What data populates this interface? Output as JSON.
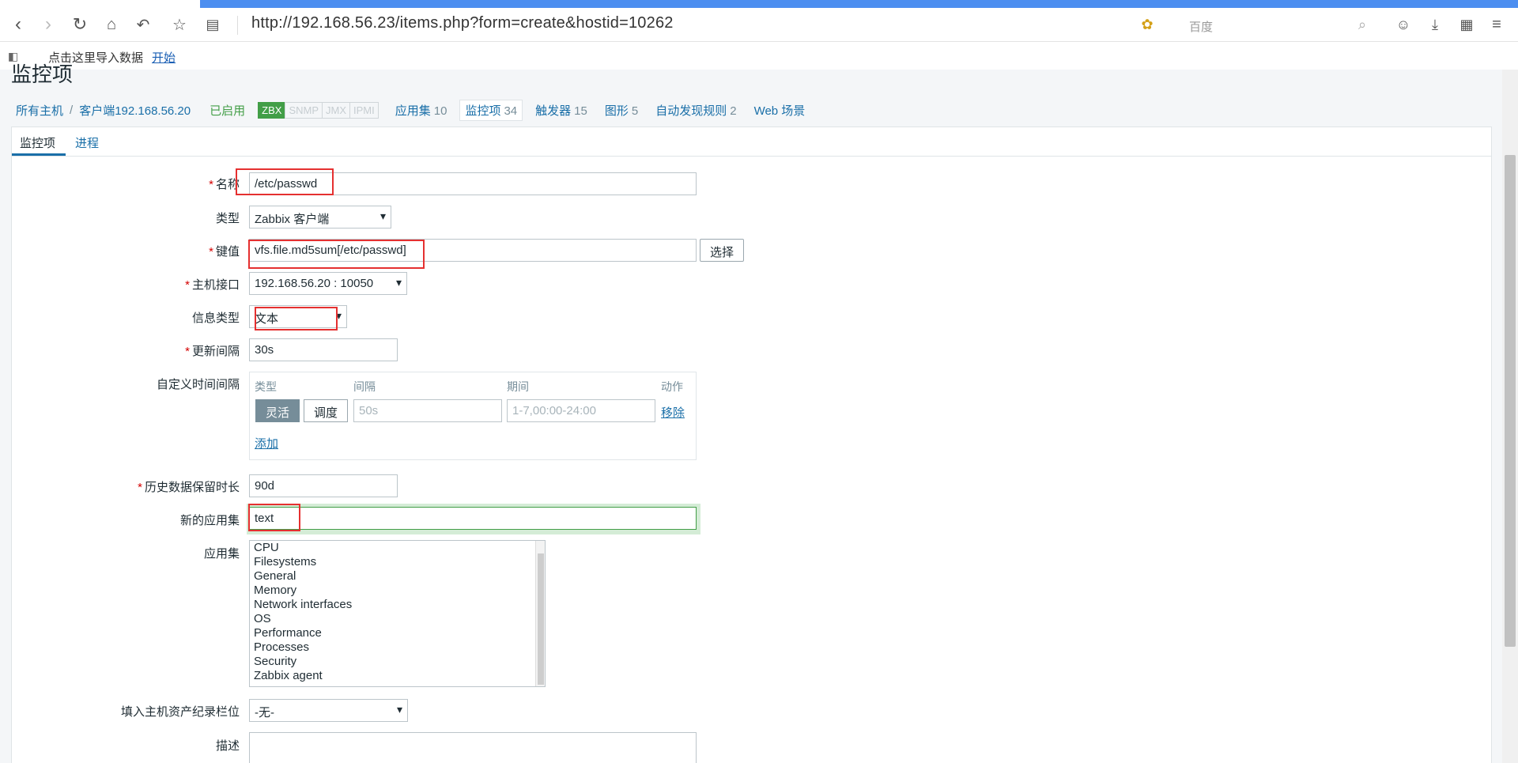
{
  "browser": {
    "url": "http://192.168.56.23/items.php?form=create&hostid=10262",
    "search_placeholder": "百度",
    "bookmark_text": "点击这里导入数据",
    "bookmark_link": "开始"
  },
  "page": {
    "title": "监控项",
    "breadcrumbs": {
      "all_hosts": "所有主机",
      "host": "客户端192.168.56.20",
      "status": "已启用"
    },
    "badges": [
      "ZBX",
      "SNMP",
      "JMX",
      "IPMI"
    ],
    "nav": [
      {
        "label": "应用集",
        "count": "10"
      },
      {
        "label": "监控项",
        "count": "34"
      },
      {
        "label": "触发器",
        "count": "15"
      },
      {
        "label": "图形",
        "count": "5"
      },
      {
        "label": "自动发现规则",
        "count": "2"
      },
      {
        "label": "Web 场景",
        "count": ""
      }
    ],
    "tabs": [
      "监控项",
      "进程"
    ]
  },
  "form": {
    "name_label": "名称",
    "name_value": "/etc/passwd",
    "type_label": "类型",
    "type_value": "Zabbix 客户端",
    "key_label": "键值",
    "key_value": "vfs.file.md5sum[/etc/passwd]",
    "select_button": "选择",
    "interface_label": "主机接口",
    "interface_value": "192.168.56.20 : 10050",
    "info_type_label": "信息类型",
    "info_type_value": "文本",
    "update_label": "更新间隔",
    "update_value": "30s",
    "custom_label": "自定义时间间隔",
    "custom": {
      "col_type": "类型",
      "col_interval": "间隔",
      "col_period": "期间",
      "col_action": "动作",
      "seg_flexible": "灵活",
      "seg_scheduling": "调度",
      "interval_placeholder": "50s",
      "period_placeholder": "1-7,00:00-24:00",
      "remove": "移除",
      "add": "添加"
    },
    "history_label": "历史数据保留时长",
    "history_value": "90d",
    "new_app_label": "新的应用集",
    "new_app_value": "text",
    "apps_label": "应用集",
    "apps": [
      "CPU",
      "Filesystems",
      "General",
      "Memory",
      "Network interfaces",
      "OS",
      "Performance",
      "Processes",
      "Security",
      "Zabbix agent"
    ],
    "inventory_label": "填入主机资产纪录栏位",
    "inventory_value": "-无-",
    "desc_label": "描述"
  }
}
